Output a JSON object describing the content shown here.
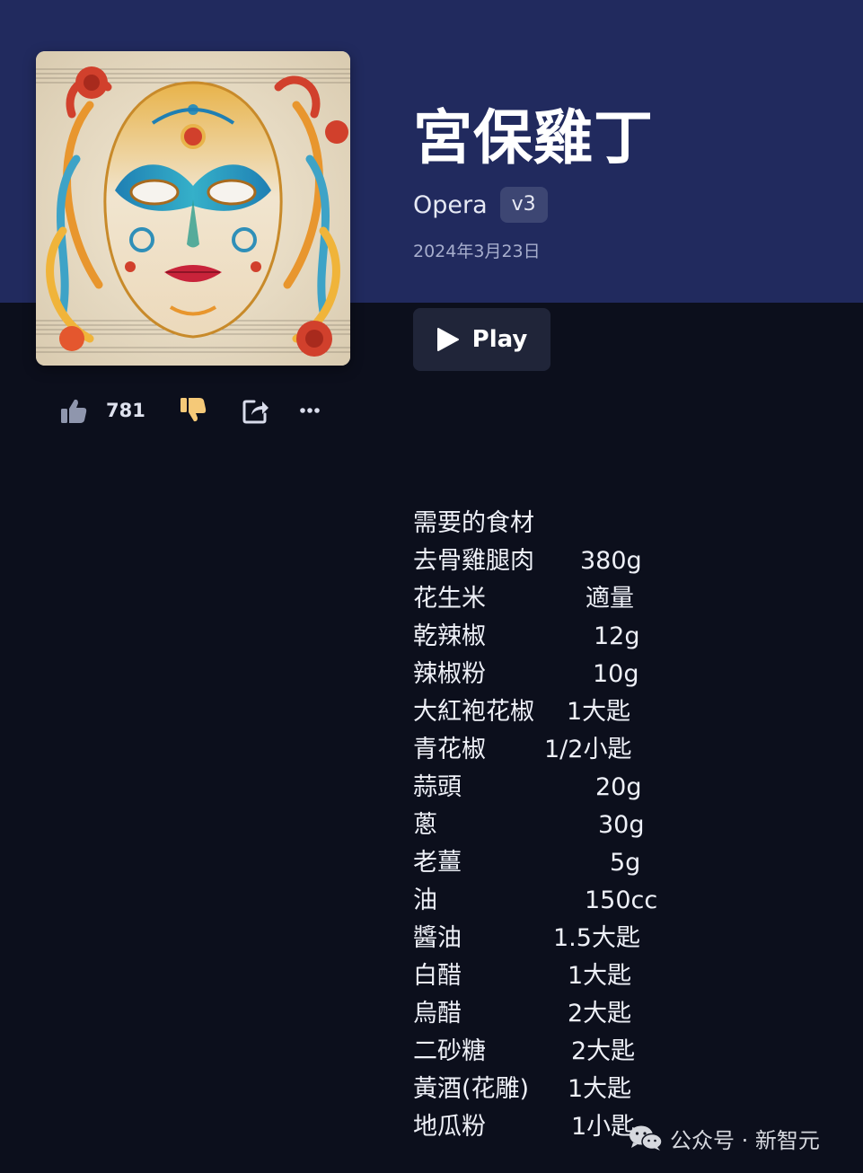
{
  "song": {
    "title": "宮保雞丁",
    "model": "Opera",
    "version": "v3",
    "date": "2024年3月23日",
    "cover_alt": "ornate venetian mask artwork"
  },
  "player": {
    "play_label": "Play"
  },
  "actions": {
    "like_count": "781"
  },
  "lyrics": {
    "heading": "需要的食材",
    "items": [
      {
        "name": "去骨雞腿肉",
        "amount": "380g"
      },
      {
        "name": "花生米",
        "amount": "適量"
      },
      {
        "name": "乾辣椒",
        "amount": "12g"
      },
      {
        "name": "辣椒粉",
        "amount": "10g"
      },
      {
        "name": "大紅袍花椒",
        "amount": "1大匙"
      },
      {
        "name": "青花椒",
        "amount": "1/2小匙"
      },
      {
        "name": "蒜頭",
        "amount": "20g"
      },
      {
        "name": "蔥",
        "amount": "30g"
      },
      {
        "name": "老薑",
        "amount": "5g"
      },
      {
        "name": "油",
        "amount": "150cc"
      },
      {
        "name": "醬油",
        "amount": "1.5大匙"
      },
      {
        "name": "白醋",
        "amount": "1大匙"
      },
      {
        "name": "烏醋",
        "amount": "2大匙"
      },
      {
        "name": "二砂糖",
        "amount": "2大匙"
      },
      {
        "name": "黃酒(花雕)",
        "amount": "1大匙"
      },
      {
        "name": "地瓜粉",
        "amount": "1小匙"
      }
    ]
  },
  "watermark": {
    "text": "公众号 · 新智元"
  },
  "icons": [
    "thumbs-up-icon",
    "thumbs-down-icon",
    "share-icon",
    "more-icon",
    "play-icon",
    "wechat-icon"
  ],
  "colors": {
    "header_bg": "#212a5e",
    "page_bg": "#0c0f1c",
    "badge_bg": "#3d4673",
    "dislike_accent": "#f5c978"
  }
}
